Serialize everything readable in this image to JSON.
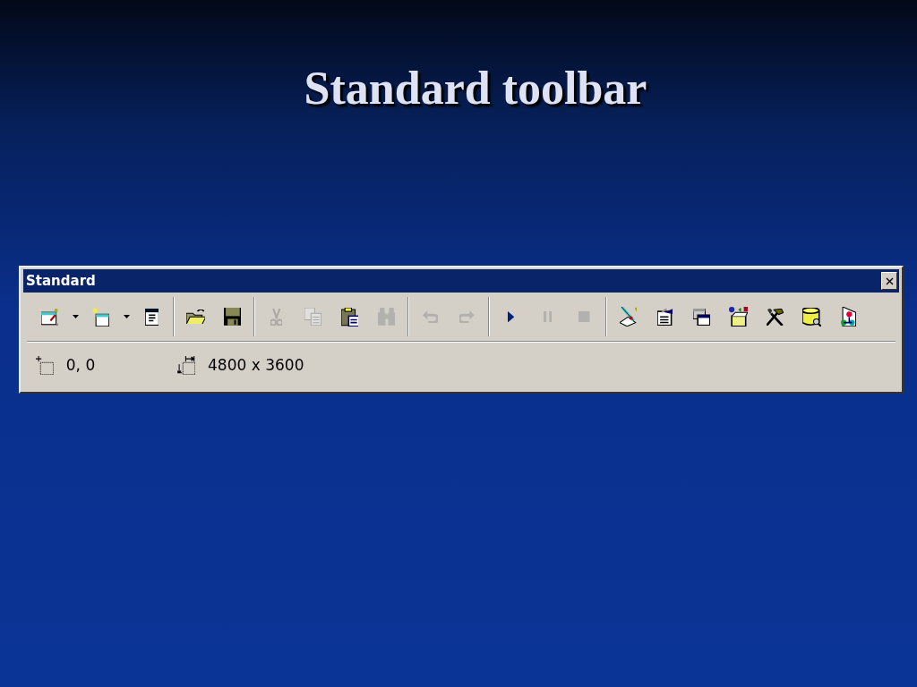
{
  "slide": {
    "title": "Standard toolbar"
  },
  "toolbar": {
    "title": "Standard",
    "groups": [
      [
        {
          "kind": "form",
          "dropdown": true,
          "disabled": false
        },
        {
          "kind": "add-item",
          "dropdown": true,
          "disabled": false
        },
        {
          "kind": "menu-editor",
          "dropdown": false,
          "disabled": false
        }
      ],
      [
        {
          "kind": "open",
          "dropdown": false,
          "disabled": false
        },
        {
          "kind": "save",
          "dropdown": false,
          "disabled": false
        }
      ],
      [
        {
          "kind": "cut",
          "dropdown": false,
          "disabled": true
        },
        {
          "kind": "copy",
          "dropdown": false,
          "disabled": true
        },
        {
          "kind": "paste",
          "dropdown": false,
          "disabled": false
        },
        {
          "kind": "find",
          "dropdown": false,
          "disabled": true
        }
      ],
      [
        {
          "kind": "undo",
          "dropdown": false,
          "disabled": true
        },
        {
          "kind": "redo",
          "dropdown": false,
          "disabled": true
        }
      ],
      [
        {
          "kind": "play",
          "dropdown": false,
          "disabled": false
        },
        {
          "kind": "pause",
          "dropdown": false,
          "disabled": true
        },
        {
          "kind": "stop",
          "dropdown": false,
          "disabled": true
        }
      ],
      [
        {
          "kind": "explorer",
          "dropdown": false,
          "disabled": false
        },
        {
          "kind": "properties",
          "dropdown": false,
          "disabled": false
        },
        {
          "kind": "layout",
          "dropdown": false,
          "disabled": false
        },
        {
          "kind": "toolbox",
          "dropdown": false,
          "disabled": false
        },
        {
          "kind": "tools",
          "dropdown": false,
          "disabled": false
        },
        {
          "kind": "data-view",
          "dropdown": false,
          "disabled": false
        },
        {
          "kind": "components",
          "dropdown": false,
          "disabled": false
        }
      ]
    ],
    "status": [
      {
        "kind": "position",
        "text": "0, 0"
      },
      {
        "kind": "size",
        "text": "4800 x 3600"
      }
    ]
  }
}
